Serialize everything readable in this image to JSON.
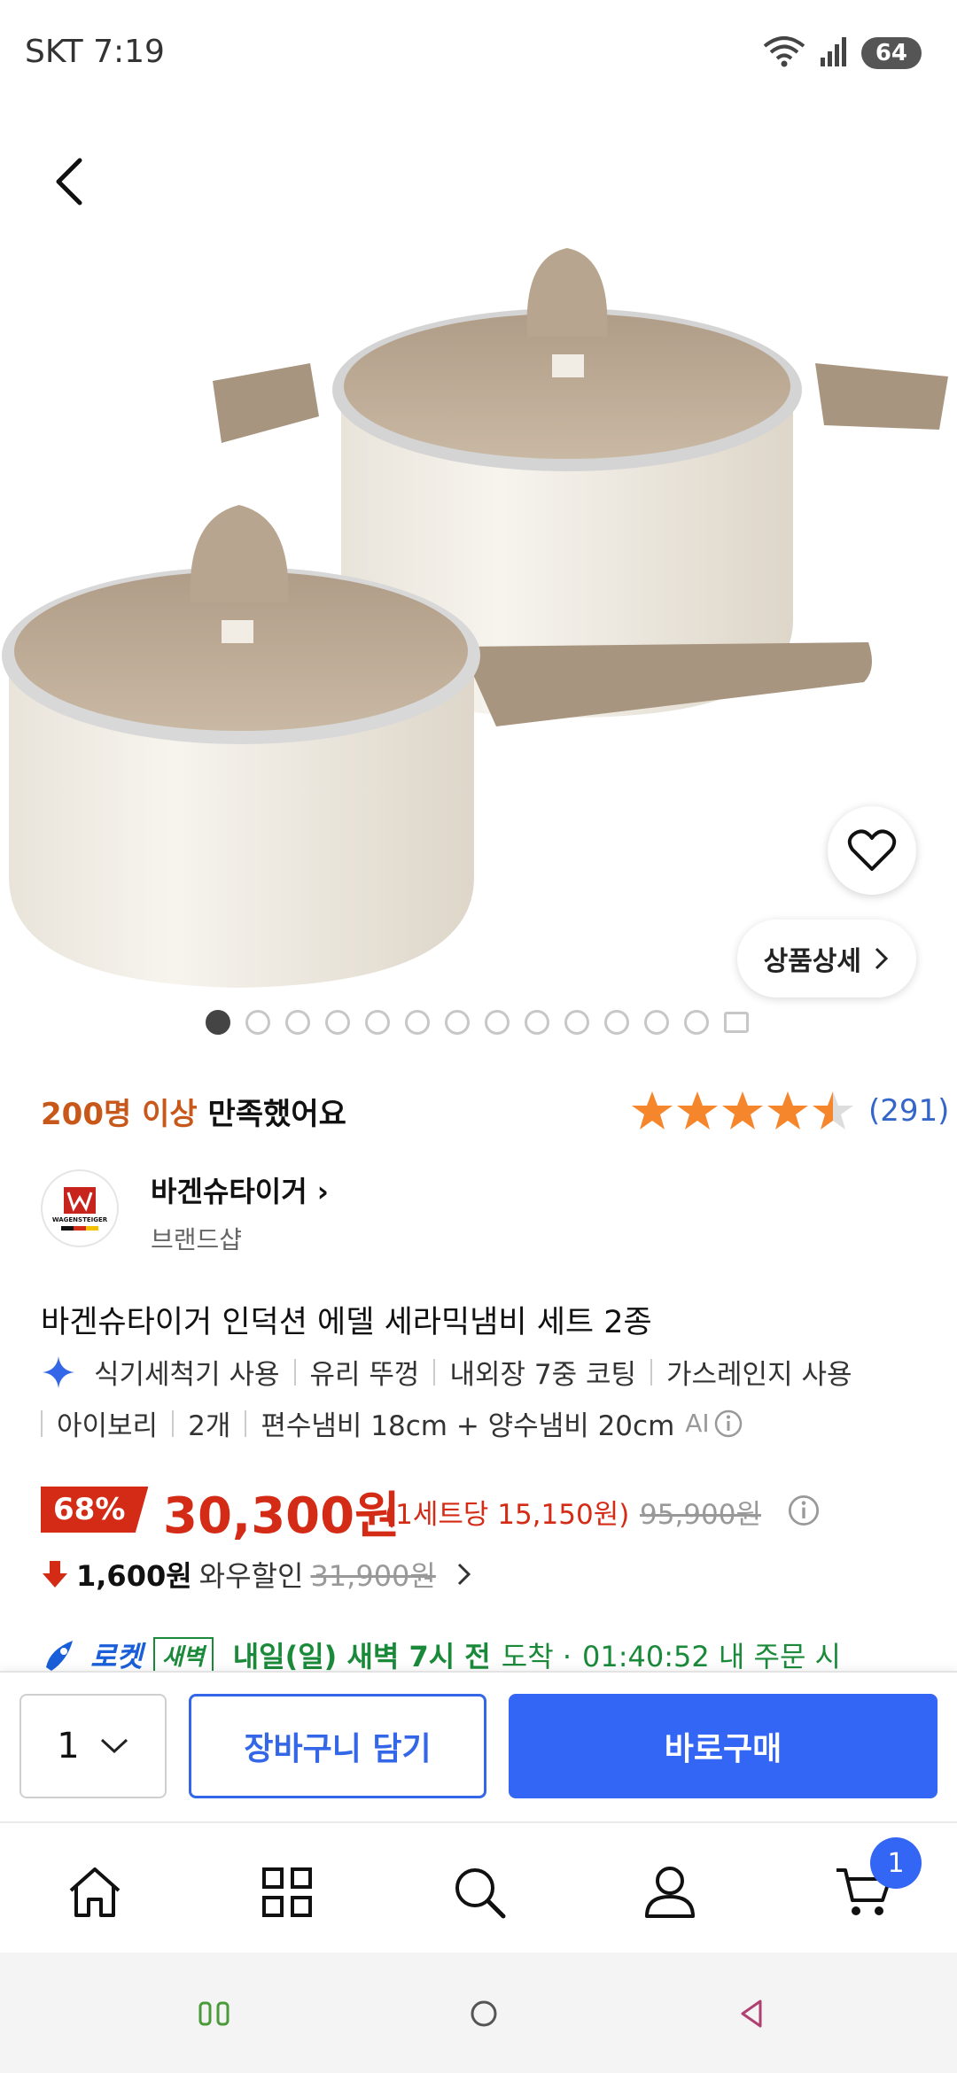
{
  "status": {
    "carrier_time": "SKT 7:19",
    "battery": "64"
  },
  "hero": {
    "detail_label": "상품상세"
  },
  "gallery": {
    "dot_count": 13,
    "active_index": 0
  },
  "satisfaction": {
    "highlight": "200명 이상",
    "text": "만족했어요"
  },
  "rating": {
    "value": 4.5,
    "max": 5,
    "count": "(291)",
    "star_color": "#f5862b"
  },
  "brand": {
    "name": "바겐슈타이거",
    "sub": "브랜드샵",
    "logo_text": "WAGENSTEIGER"
  },
  "product": {
    "title": "바겐슈타이거 인덕션 에델 세라믹냄비 세트 2종",
    "features": [
      "식기세척기 사용",
      "유리 뚜껑",
      "내외장 7중 코팅",
      "가스레인지 사용"
    ],
    "options": [
      "아이보리",
      "2개",
      "편수냄비 18cm + 양수냄비 20cm"
    ],
    "ai_label": "AI"
  },
  "price": {
    "discount": "68%",
    "sale": "30,300원",
    "per_set": "(1세트당 15,150원)",
    "original": "95,900원",
    "sale_color": "#d32b15"
  },
  "wow": {
    "amount": "1,600원",
    "label": "와우할인",
    "original": "31,900원"
  },
  "delivery": {
    "rocket_label": "로켓",
    "rocket_tag": "새벽",
    "eta": "내일(일) 새벽 7시 전",
    "eta_suffix": "도착 ·",
    "countdown": "01:40:52 내 주문 시"
  },
  "purchase": {
    "quantity": "1",
    "cart_label": "장바구니 담기",
    "buy_label": "바로구매",
    "accent": "#3466f5"
  },
  "nav": {
    "cart_badge": "1",
    "items": [
      "home-icon",
      "category-icon",
      "search-icon",
      "user-icon",
      "cart-icon"
    ]
  }
}
